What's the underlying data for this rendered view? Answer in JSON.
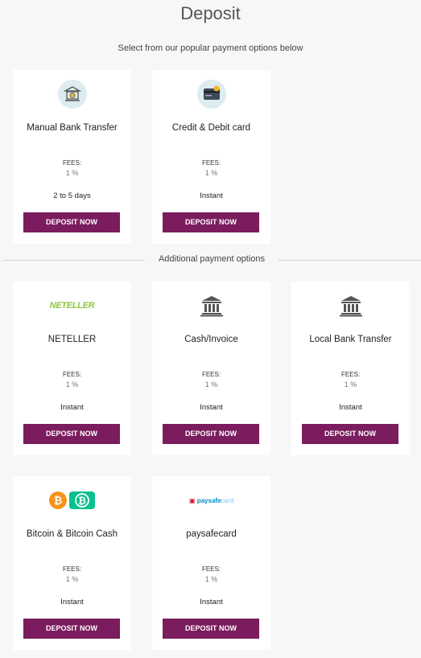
{
  "page": {
    "title": "Deposit",
    "subtitle": "Select from our popular payment options below",
    "divider_label": "Additional payment options"
  },
  "colors": {
    "button_bg": "#7b1c5e",
    "icon_circle_bg": "#dcecef",
    "neteller_green": "#8dc63f"
  },
  "popular": [
    {
      "name": "Manual Bank Transfer",
      "icon": "bank-transfer-icon",
      "fees_label": "FEES:",
      "fees": "1 %",
      "time": "2 to 5 days",
      "button": "DEPOSIT NOW"
    },
    {
      "name": "Credit & Debit card",
      "icon": "credit-card-icon",
      "fees_label": "FEES:",
      "fees": "1 %",
      "time": "Instant",
      "button": "DEPOSIT NOW"
    }
  ],
  "additional": [
    {
      "name": "NETELLER",
      "icon": "neteller-logo",
      "logo_text": "NETELLER",
      "fees_label": "FEES:",
      "fees": "1 %",
      "time": "Instant",
      "button": "DEPOSIT NOW"
    },
    {
      "name": "Cash/Invoice",
      "icon": "bank-building-icon",
      "fees_label": "FEES:",
      "fees": "1 %",
      "time": "Instant",
      "button": "DEPOSIT NOW"
    },
    {
      "name": "Local Bank Transfer",
      "icon": "bank-building-icon",
      "fees_label": "FEES:",
      "fees": "1 %",
      "time": "Instant",
      "button": "DEPOSIT NOW"
    },
    {
      "name": "Bitcoin & Bitcoin Cash",
      "icon": "bitcoin-icons",
      "fees_label": "FEES:",
      "fees": "1 %",
      "time": "Instant",
      "button": "DEPOSIT NOW"
    },
    {
      "name": "paysafecard",
      "icon": "paysafecard-logo",
      "logo_text_a": "paysafe",
      "logo_text_b": "card",
      "fees_label": "FEES:",
      "fees": "1 %",
      "time": "Instant",
      "button": "DEPOSIT NOW"
    }
  ]
}
